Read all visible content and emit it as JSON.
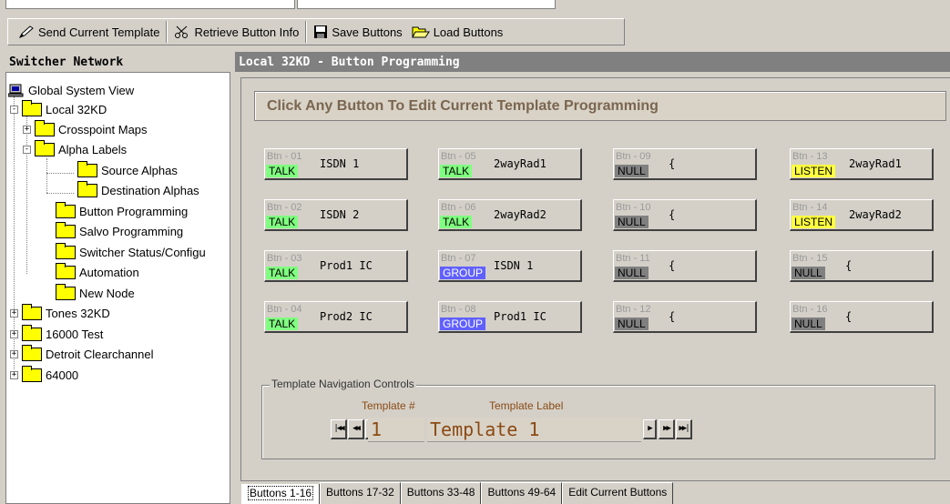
{
  "toolbar": {
    "send": "Send Current Template",
    "retrieve": "Retrieve Button Info",
    "save": "Save Buttons",
    "load": "Load Buttons"
  },
  "left_panel": {
    "title": "Switcher Network",
    "tree": {
      "root": "Global System View",
      "local": "Local 32KD",
      "crosspoint": "Crosspoint Maps",
      "alpha": "Alpha Labels",
      "source": "Source Alphas",
      "destination": "Destination Alphas",
      "button_prog": "Button Programming",
      "salvo": "Salvo Programming",
      "switcher_status": "Switcher Status/Configu",
      "automation": "Automation",
      "new_node": "New Node",
      "tones": "Tones 32KD",
      "test16000": "16000 Test",
      "detroit": "Detroit Clearchannel",
      "n64000": "64000"
    }
  },
  "right_panel": {
    "title": "Local 32KD - Button Programming",
    "instruction": "Click Any Button To Edit Current Template Programming"
  },
  "buttons": [
    {
      "num": "Btn - 01",
      "tag": "TALK",
      "label": "ISDN 1"
    },
    {
      "num": "Btn - 02",
      "tag": "TALK",
      "label": "ISDN 2"
    },
    {
      "num": "Btn - 03",
      "tag": "TALK",
      "label": "Prod1 IC"
    },
    {
      "num": "Btn - 04",
      "tag": "TALK",
      "label": "Prod2 IC"
    },
    {
      "num": "Btn - 05",
      "tag": "TALK",
      "label": "2wayRad1"
    },
    {
      "num": "Btn - 06",
      "tag": "TALK",
      "label": "2wayRad2"
    },
    {
      "num": "Btn - 07",
      "tag": "GROUP",
      "label": "ISDN 1"
    },
    {
      "num": "Btn - 08",
      "tag": "GROUP",
      "label": "Prod1 IC"
    },
    {
      "num": "Btn - 09",
      "tag": "NULL",
      "label": "{"
    },
    {
      "num": "Btn - 10",
      "tag": "NULL",
      "label": "{"
    },
    {
      "num": "Btn - 11",
      "tag": "NULL",
      "label": "{"
    },
    {
      "num": "Btn - 12",
      "tag": "NULL",
      "label": "{"
    },
    {
      "num": "Btn - 13",
      "tag": "LISTEN",
      "label": "2wayRad1"
    },
    {
      "num": "Btn - 14",
      "tag": "LISTEN",
      "label": "2wayRad2"
    },
    {
      "num": "Btn - 15",
      "tag": "NULL",
      "label": "{"
    },
    {
      "num": "Btn - 16",
      "tag": "NULL",
      "label": "{"
    }
  ],
  "nav": {
    "legend": "Template Navigation Controls",
    "num_header": "Template #",
    "label_header": "Template Label",
    "num_value": "1",
    "label_value": "Template 1"
  },
  "tabs": [
    "Buttons 1-16",
    "Buttons 17-32",
    "Buttons 33-48",
    "Buttons 49-64",
    "Edit Current Buttons"
  ],
  "colors": {
    "talk": "#80ff80",
    "listen": "#ffff40",
    "group": "#6060ff",
    "null": "#808080",
    "accent_text": "#8b4a14"
  }
}
